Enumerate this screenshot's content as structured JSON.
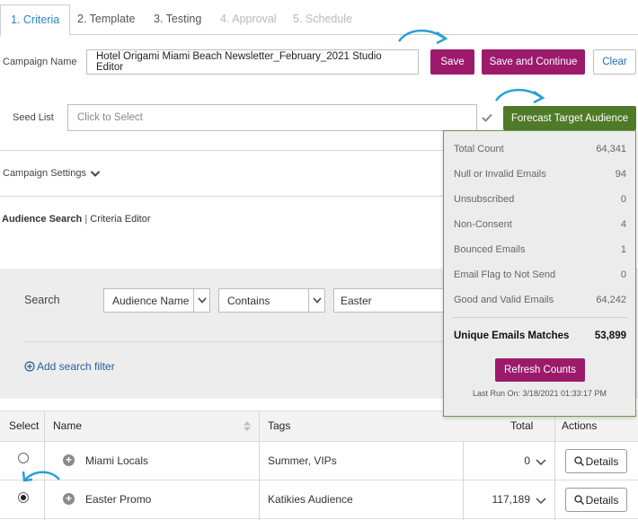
{
  "tabs": [
    {
      "label": "1. Criteria",
      "state": "active"
    },
    {
      "label": "2. Template",
      "state": "normal"
    },
    {
      "label": "3. Testing",
      "state": "normal"
    },
    {
      "label": "4. Approval",
      "state": "disabled"
    },
    {
      "label": "5. Schedule",
      "state": "disabled"
    }
  ],
  "campaign": {
    "label": "Campaign Name",
    "value": "Hotel Origami Miami Beach Newsletter_February_2021 Studio Editor",
    "save_label": "Save",
    "save_continue_label": "Save and Continue",
    "clear_label": "Clear"
  },
  "seed": {
    "label": "Seed List",
    "placeholder": "Click to Select",
    "forecast_label": "Forecast Target Audience"
  },
  "settings": {
    "label": "Campaign Settings"
  },
  "audience": {
    "title": "Audience Search",
    "separator": " | ",
    "subtitle": "Criteria Editor"
  },
  "search": {
    "label": "Search",
    "field": "Audience Name",
    "operator": "Contains",
    "value": "Easter",
    "add_filter_label": "Add search filter"
  },
  "table": {
    "headers": {
      "select": "Select",
      "name": "Name",
      "tags": "Tags",
      "total": "Total",
      "actions": "Actions"
    },
    "rows": [
      {
        "selected": false,
        "name": "Miami Locals",
        "tags": "Summer, VIPs",
        "total": "0",
        "action": "Details"
      },
      {
        "selected": true,
        "name": "Easter Promo",
        "tags": "Katikies Audience",
        "total": "117,189",
        "action": "Details"
      }
    ]
  },
  "forecast": {
    "stats": [
      {
        "label": "Total Count",
        "value": "64,341"
      },
      {
        "label": "Null or Invalid Emails",
        "value": "94"
      },
      {
        "label": "Unsubscribed",
        "value": "0"
      },
      {
        "label": "Non-Consent",
        "value": "4"
      },
      {
        "label": "Bounced Emails",
        "value": "1"
      },
      {
        "label": "Email Flag to Not Send",
        "value": "0"
      },
      {
        "label": "Good and Valid Emails",
        "value": "64,242"
      }
    ],
    "unique_label": "Unique Emails Matches",
    "unique_value": "53,899",
    "refresh_label": "Refresh Counts",
    "last_run": "Last Run On: 3/18/2021 01:33:17 PM"
  },
  "colors": {
    "accent": "#2a86c9",
    "primary": "#9c1a6b",
    "green": "#4f7a27",
    "annotation": "#2a9fd6"
  }
}
